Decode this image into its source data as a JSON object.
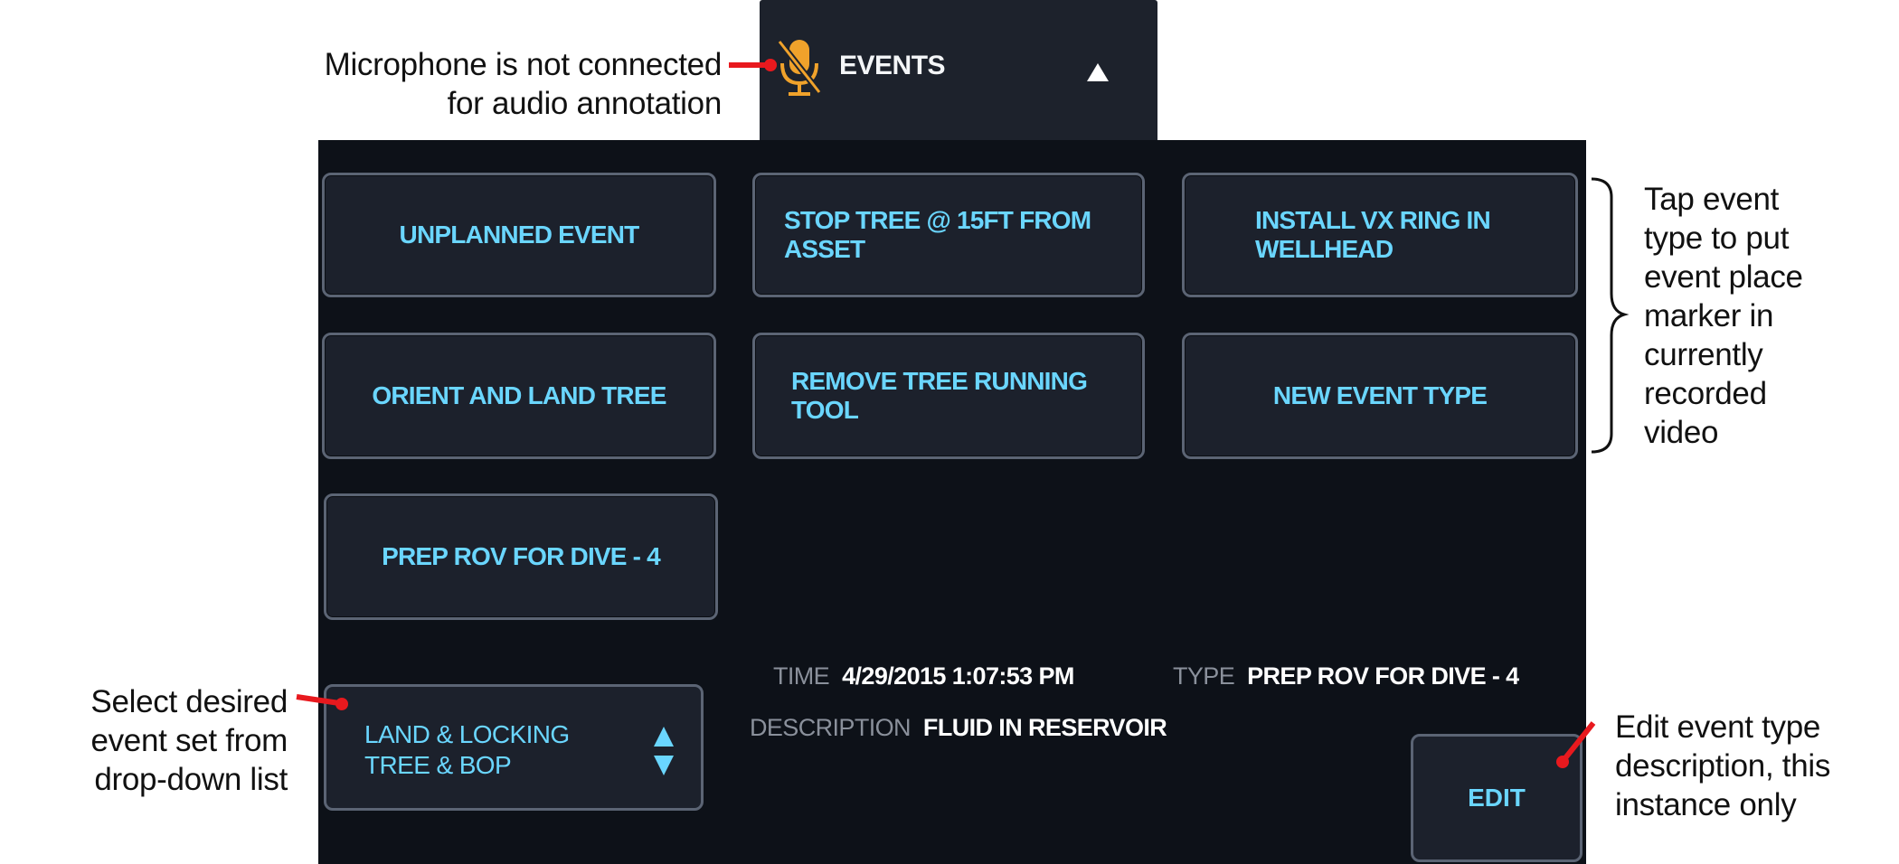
{
  "colors": {
    "accent": "#6ad6ff",
    "panel": "#0d1118",
    "button": "#1c212c",
    "border": "#5b6474",
    "warning": "#f0a22b",
    "callout": "#e8191e"
  },
  "header": {
    "title": "EVENTS",
    "mic_icon": "microphone-disconnected-icon",
    "collapse_icon": "triangle-up-icon"
  },
  "event_buttons": [
    {
      "label": "UNPLANNED EVENT"
    },
    {
      "label": "STOP TREE @ 15FT FROM ASSET"
    },
    {
      "label": "INSTALL VX RING IN WELLHEAD"
    },
    {
      "label": "ORIENT AND LAND TREE"
    },
    {
      "label": "REMOVE TREE RUNNING TOOL"
    },
    {
      "label": "NEW EVENT TYPE"
    },
    {
      "label": "PREP ROV FOR DIVE - 4"
    }
  ],
  "info": {
    "time_label": "TIME",
    "time_value": "4/29/2015 1:07:53 PM",
    "type_label": "TYPE",
    "type_value": "PREP ROV FOR DIVE - 4",
    "description_label": "DESCRIPTION",
    "description_value": "FLUID IN RESERVOIR"
  },
  "event_set": {
    "line1": "LAND & LOCKING",
    "line2": "TREE & BOP",
    "arrows_icon": "up-down-arrows-icon"
  },
  "edit_label": "EDIT",
  "annotations": {
    "mic": [
      "Microphone is not connected",
      "for audio annotation"
    ],
    "tap": [
      "Tap event",
      "type to put",
      "event place",
      "marker in",
      "currently",
      "recorded",
      "video"
    ],
    "select": [
      "Select desired",
      "event set from",
      "drop-down list"
    ],
    "edit": [
      "Edit event type",
      "description, this",
      "instance only"
    ]
  }
}
